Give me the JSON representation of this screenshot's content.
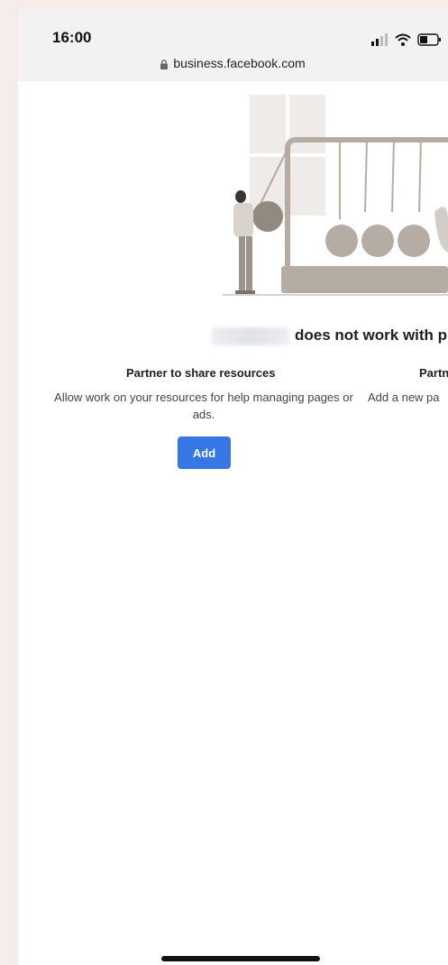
{
  "status_bar": {
    "time": "16:00"
  },
  "browser": {
    "url": "business.facebook.com"
  },
  "main": {
    "heading_suffix": "does not work with p",
    "columns": [
      {
        "title": "Partner to share resources",
        "description": "Allow work on your resources for help managing pages or ads.",
        "button_label": "Add"
      },
      {
        "title": "Partn",
        "description": "Add a new pa"
      }
    ]
  },
  "colors": {
    "button": "#3578e5",
    "illustration": "#b5aca4"
  }
}
